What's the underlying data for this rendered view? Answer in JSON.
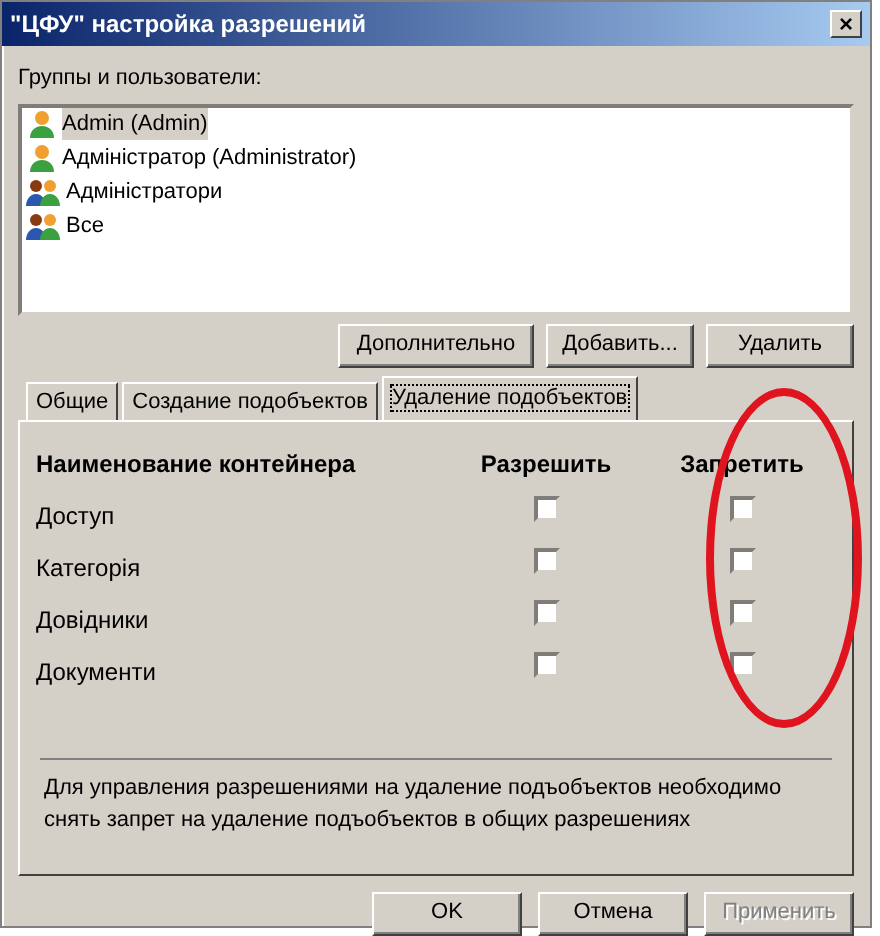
{
  "window": {
    "title": "\"ЦФУ\" настройка разрешений",
    "close": "×"
  },
  "principals_label": "Группы и пользователи:",
  "principals": [
    {
      "name": "Admin (Admin)",
      "kind": "user",
      "selected": true
    },
    {
      "name": "Адміністратор (Administrator)",
      "kind": "user",
      "selected": false
    },
    {
      "name": "Адміністратори",
      "kind": "group",
      "selected": false
    },
    {
      "name": "Все",
      "kind": "group",
      "selected": false
    }
  ],
  "list_buttons": [
    "Дополнительно",
    "Добавить...",
    "Удалить"
  ],
  "tabs": [
    {
      "label": "Общие",
      "selected": false
    },
    {
      "label": "Создание подобъектов",
      "selected": false
    },
    {
      "label": "Удаление подобъектов",
      "selected": true
    }
  ],
  "table": {
    "columns": [
      "Наименование контейнера",
      "Разрешить",
      "Запретить"
    ],
    "rows": [
      {
        "name": "Доступ",
        "allow": false,
        "deny": false
      },
      {
        "name": "Категорія",
        "allow": false,
        "deny": false
      },
      {
        "name": "Довідники",
        "allow": false,
        "deny": false
      },
      {
        "name": "Документи",
        "allow": false,
        "deny": false
      }
    ]
  },
  "note": "Для управления разрешениями на удаление подъобъектов необходимо снять запрет на удаление подъобъектов в общих разрешениях",
  "annotation": {
    "kind": "ellipse",
    "color": "#e0141e"
  },
  "buttons": [
    {
      "label": "OK",
      "disabled": false
    },
    {
      "label": "Отмена",
      "disabled": false
    },
    {
      "label": "Применить",
      "disabled": true
    }
  ]
}
